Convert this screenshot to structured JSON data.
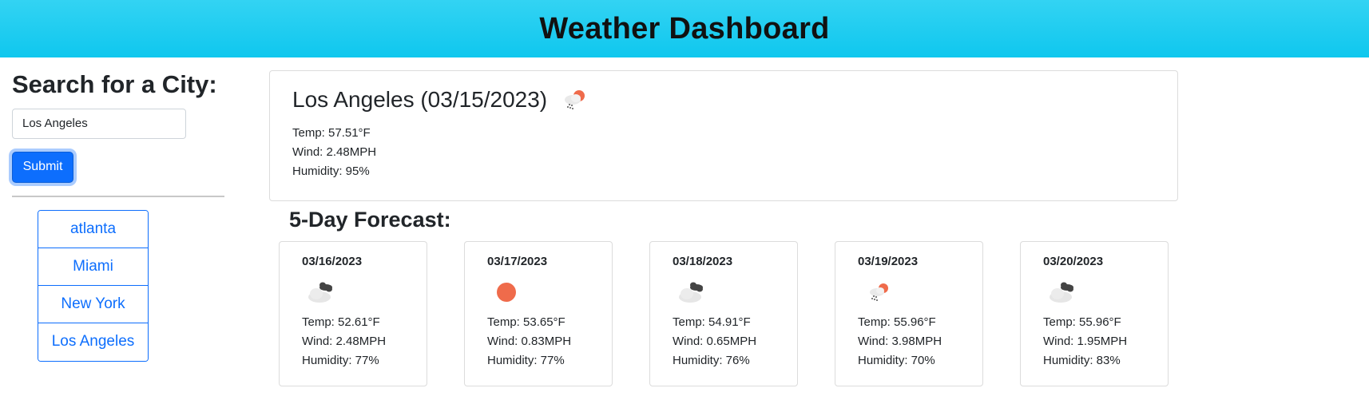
{
  "header": {
    "title": "Weather Dashboard"
  },
  "search": {
    "heading": "Search for a City:",
    "input_value": "Los Angeles",
    "submit_label": "Submit"
  },
  "history": [
    "atlanta",
    "Miami",
    "New York",
    "Los Angeles"
  ],
  "current": {
    "title": "Los Angeles (03/15/2023)",
    "icon": "sun-cloud-rain-icon",
    "temp": "Temp: 57.51°F",
    "wind": "Wind: 2.48MPH",
    "humidity": "Humidity: 95%"
  },
  "forecast": {
    "heading": "5-Day Forecast:",
    "days": [
      {
        "date": "03/16/2023",
        "icon": "cloudy-icon",
        "temp": "Temp: 52.61°F",
        "wind": "Wind: 2.48MPH",
        "humidity": "Humidity: 77%"
      },
      {
        "date": "03/17/2023",
        "icon": "sun-icon",
        "temp": "Temp: 53.65°F",
        "wind": "Wind: 0.83MPH",
        "humidity": "Humidity: 77%"
      },
      {
        "date": "03/18/2023",
        "icon": "cloudy-icon",
        "temp": "Temp: 54.91°F",
        "wind": "Wind: 0.65MPH",
        "humidity": "Humidity: 76%"
      },
      {
        "date": "03/19/2023",
        "icon": "sun-cloud-rain-icon",
        "temp": "Temp: 55.96°F",
        "wind": "Wind: 3.98MPH",
        "humidity": "Humidity: 70%"
      },
      {
        "date": "03/20/2023",
        "icon": "cloudy-icon",
        "temp": "Temp: 55.96°F",
        "wind": "Wind: 1.95MPH",
        "humidity": "Humidity: 83%"
      }
    ]
  },
  "colors": {
    "accent": "#0d6efd",
    "header": "#1ccbf0",
    "sun": "#ef6b4b"
  }
}
